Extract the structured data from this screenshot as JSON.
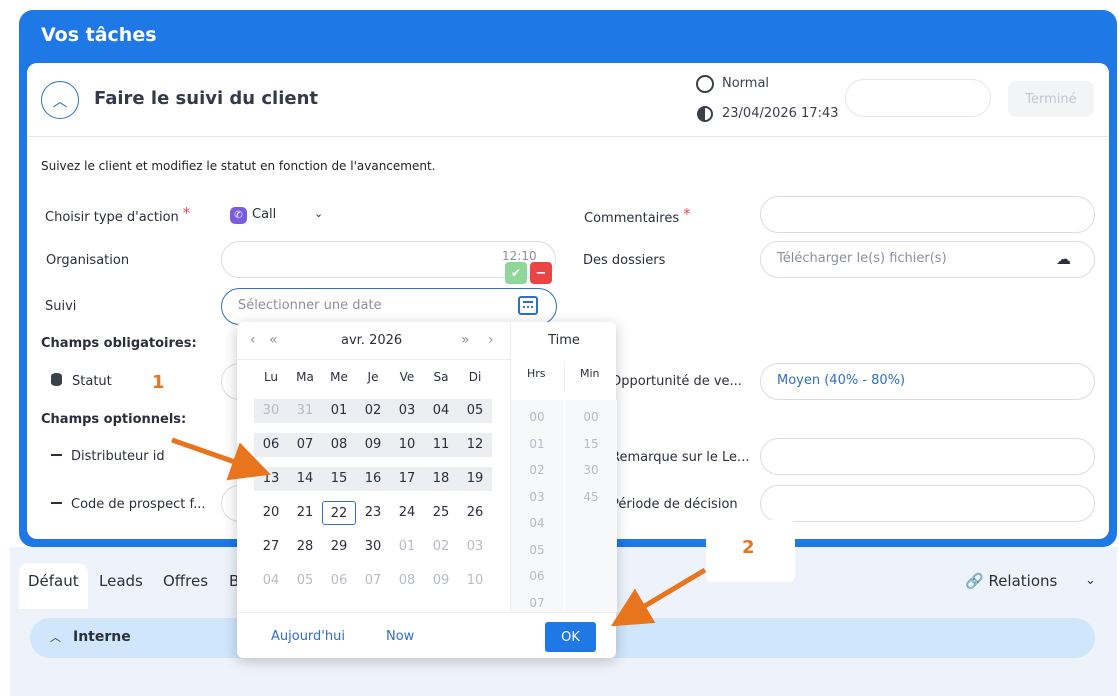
{
  "panel": {
    "title": "Vos tâches"
  },
  "task": {
    "title": "Faire le suivi du client",
    "priority": "Normal",
    "due_date": "23/04/2026 17:43",
    "done_label": "Terminé",
    "description": "Suivez le client et modifiez le statut en fonction de l'avancement."
  },
  "form": {
    "action_type_label": "Choisir type d'action",
    "action_type_value": "Call",
    "organisation_label": "Organisation",
    "organisation_time": "12:10",
    "suivi_label": "Suivi",
    "suivi_placeholder": "Sélectionner une date",
    "required_title": "Champs obligatoires:",
    "statut_label": "Statut",
    "optional_title": "Champs optionnels:",
    "distributor_label": "Distributeur id",
    "prospect_label": "Code de prospect f...",
    "comments_label": "Commentaires",
    "files_label": "Des dossiers",
    "files_placeholder": "Télécharger le(s) fichier(s)",
    "opportunity_label": "Opportunité de ve...",
    "opportunity_value": "Moyen (40% - 80%)",
    "lead_remark_label": "Remarque sur le Le...",
    "decision_period_label": "Période de décision",
    "required_mark": "*"
  },
  "tabs": {
    "items": [
      "Défaut",
      "Leads",
      "Offres",
      "B"
    ],
    "relations_label": "Relations",
    "internal_section": "Interne"
  },
  "datepicker": {
    "month_label": "avr.  2026",
    "weekdays": [
      "Lu",
      "Ma",
      "Me",
      "Je",
      "Ve",
      "Sa",
      "Di"
    ],
    "weeks": [
      [
        "30",
        "31",
        "01",
        "02",
        "03",
        "04",
        "05"
      ],
      [
        "06",
        "07",
        "08",
        "09",
        "10",
        "11",
        "12"
      ],
      [
        "13",
        "14",
        "15",
        "16",
        "17",
        "18",
        "19"
      ],
      [
        "20",
        "21",
        "22",
        "23",
        "24",
        "25",
        "26"
      ],
      [
        "27",
        "28",
        "29",
        "30",
        "01",
        "02",
        "03"
      ],
      [
        "04",
        "05",
        "06",
        "07",
        "08",
        "09",
        "10"
      ]
    ],
    "today": "22",
    "time_title": "Time",
    "hours_label": "Hrs",
    "minutes_label": "Min",
    "hours": [
      "00",
      "01",
      "02",
      "03",
      "04",
      "05",
      "06",
      "07"
    ],
    "minutes": [
      "00",
      "15",
      "30",
      "45"
    ],
    "today_button": "Aujourd'hui",
    "now_button": "Now",
    "ok_button": "OK"
  },
  "annotations": {
    "step1": "1",
    "step2": "2"
  },
  "colors": {
    "primary": "#1e78e6",
    "annotation": "#e8741e",
    "danger": "#e94545",
    "success": "#8fd69a"
  }
}
